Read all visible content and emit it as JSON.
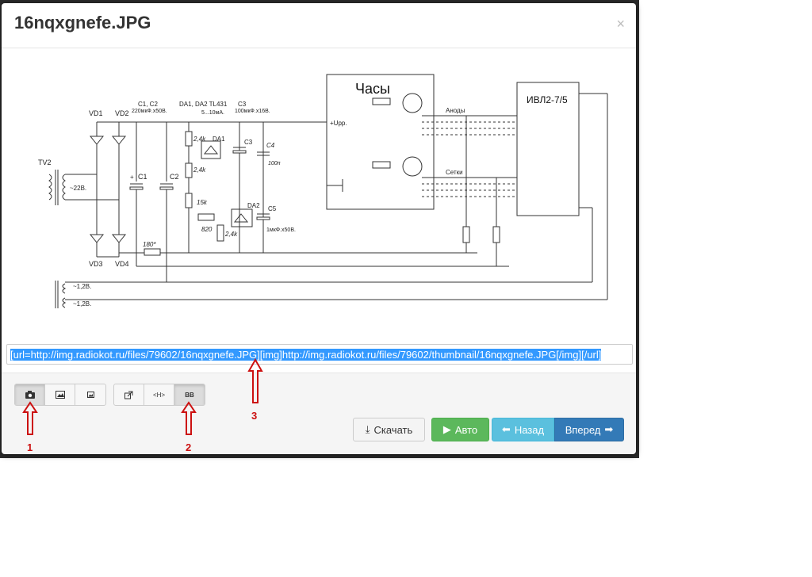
{
  "modal": {
    "title": "16nqxgnefe.JPG",
    "close": "×"
  },
  "diagram": {
    "labels": {
      "vd1": "VD1",
      "vd2": "VD2",
      "vd3": "VD3",
      "vd4": "VD4",
      "c1c2": "C1, C2",
      "c1c2_val": "220мкФ.х50В.",
      "da": "DA1, DA2 TL431",
      "da_cur": "5...10мА.",
      "c3": "C3",
      "c3_val": "100мкФ.х16В.",
      "tv2": "TV2",
      "v22": "~22В.",
      "c1": "C1",
      "c2": "C2",
      "c3b": "C3",
      "c4": "C4",
      "c4_val": "100п",
      "da1": "DA1",
      "da2": "DA2",
      "c5": "C5",
      "c5_val": "1мкФ.х50В.",
      "r1": "2,4k",
      "r2": "2,4k",
      "r3": "15k",
      "r4": "820",
      "r5": "2,4k",
      "r180": "180*",
      "upp": "+Upp.",
      "v12a": "~1,2В.",
      "v12b": "~1,2В.",
      "clock": "Часы",
      "anodes": "Аноды",
      "grids": "Сетки",
      "ivl": "ИВЛ2-7/5",
      "plus": "+"
    }
  },
  "url_field": {
    "value": "[url=http://img.radiokot.ru/files/79602/16nqxgnefe.JPG][img]http://img.radiokot.ru/files/79602/thumbnail/16nqxgnefe.JPG[/img][/url]"
  },
  "toolbar": {
    "group1": [
      {
        "name": "camera-icon",
        "glyph": "📷"
      },
      {
        "name": "image-icon",
        "glyph": "🖼"
      },
      {
        "name": "small-image-icon",
        "glyph": "▪"
      }
    ],
    "group2": [
      {
        "name": "external-link-icon",
        "glyph": "↗"
      },
      {
        "name": "html-code-icon",
        "glyph": "<H>"
      },
      {
        "name": "bbcode-icon",
        "glyph": "BB"
      }
    ]
  },
  "buttons": {
    "download": "Скачать",
    "download_icon": "⤓",
    "auto": "Авто",
    "auto_icon": "▶",
    "back": "Назад",
    "back_icon": "⬅",
    "next": "Вперед",
    "next_icon": "➡"
  },
  "annotations": {
    "n1": "1",
    "n2": "2",
    "n3": "3"
  },
  "colors": {
    "annotation": "#cc1111",
    "selection": "#3399ff",
    "success": "#5cb85c",
    "info": "#5bc0de",
    "primary": "#337ab7"
  }
}
